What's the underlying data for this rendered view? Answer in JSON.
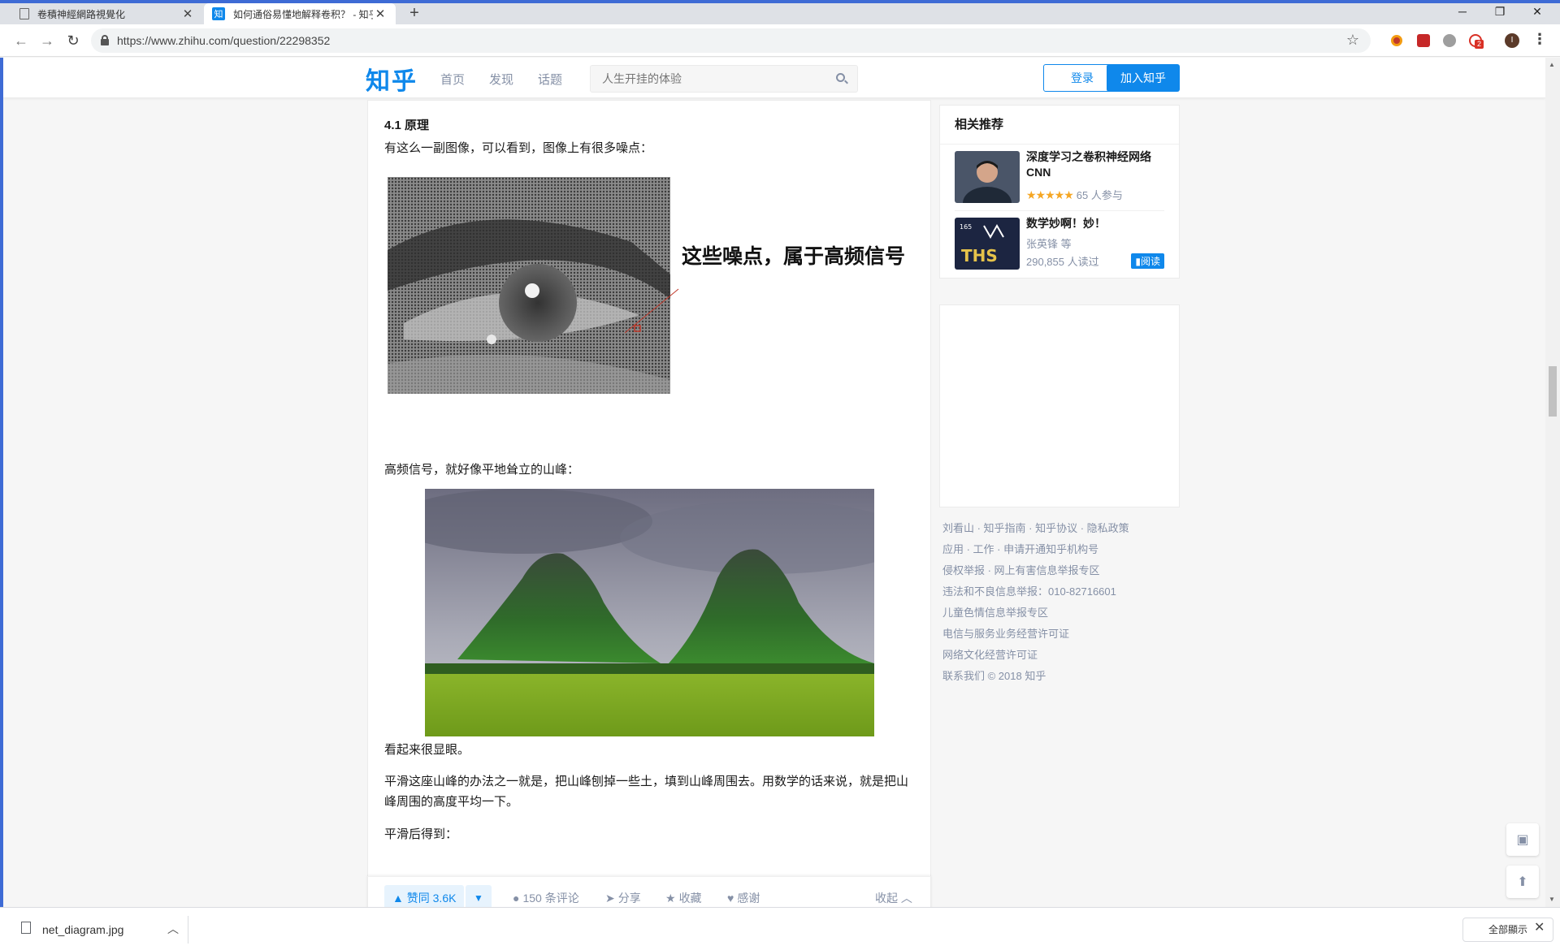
{
  "browser": {
    "tabs": [
      {
        "title": "卷積神經網路視覺化",
        "active": false
      },
      {
        "title": "如何通俗易懂地解释卷积？ - 知乎",
        "active": true
      }
    ],
    "new_tab": "+",
    "url": "https://www.zhihu.com/question/22298352",
    "profile_initial": "I",
    "extension_badge": "2",
    "window_controls": {
      "minimize": "─",
      "restore": "❐",
      "close": "✕"
    }
  },
  "zhihu_header": {
    "logo": "知乎",
    "nav": [
      "首页",
      "发现",
      "话题"
    ],
    "search_placeholder": "人生开挂的体验",
    "login": "登录",
    "join": "加入知乎"
  },
  "article": {
    "section_title": "4.1 原理",
    "para1": "有这么一副图像，可以看到，图像上有很多噪点：",
    "eye_annotation": "这些噪点，属于高频信号",
    "para2": "高频信号，就好像平地耸立的山峰：",
    "para3": "看起来很显眼。",
    "para4": "平滑这座山峰的办法之一就是，把山峰刨掉一些土，填到山峰周围去。用数学的话来说，就是把山峰周围的高度平均一下。",
    "para5": "平滑后得到："
  },
  "actions": {
    "upvote": "赞同 3.6K",
    "comments": "150 条评论",
    "share": "分享",
    "favorite": "收藏",
    "thanks": "感谢",
    "collapse": "收起"
  },
  "sidebar": {
    "title": "相关推荐",
    "items": [
      {
        "title": "深度学习之卷积神经网络CNN",
        "rating": 4.5,
        "meta": "65 人参与"
      },
      {
        "title": "数学妙啊！妙！",
        "author": "张英锋 等",
        "meta": "290,855 人读过",
        "button": "阅读"
      }
    ],
    "footer": [
      "刘看山 · 知乎指南 · 知乎协议 · 隐私政策",
      "应用 · 工作 · 申请开通知乎机构号",
      "侵权举报 · 网上有害信息举报专区",
      "违法和不良信息举报：010-82716601",
      "儿童色情信息举报专区",
      "电信与服务业务经营许可证",
      "网络文化经营许可证",
      "联系我们 © 2018 知乎"
    ]
  },
  "download_bar": {
    "filename": "net_diagram.jpg",
    "show_all": "全部顯示"
  },
  "colors": {
    "brand": "#0f88eb",
    "window_accent": "#3e6bd5",
    "muted_text": "#8590a6",
    "star": "#f5a623"
  }
}
